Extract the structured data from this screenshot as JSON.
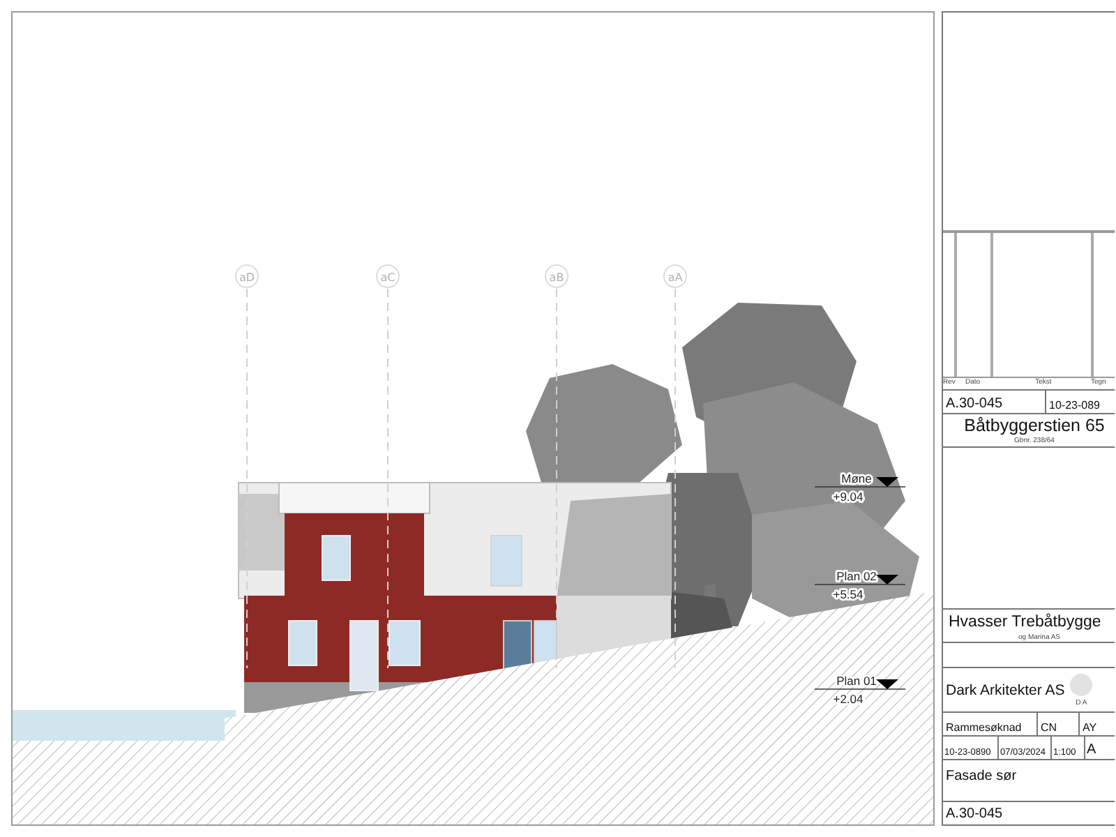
{
  "elevation": {
    "grid_lines": [
      {
        "label": "aD"
      },
      {
        "label": "aC"
      },
      {
        "label": "aB"
      },
      {
        "label": "aA"
      }
    ],
    "levels": [
      {
        "name": "Møne",
        "elevation": "+9.04"
      },
      {
        "name": "Plan 02",
        "elevation": "+5.54"
      },
      {
        "name": "Plan 01",
        "elevation": "+2.04"
      }
    ]
  },
  "title_block": {
    "revision_headers": [
      "Rev",
      "Dato",
      "Tekst",
      "Tegn"
    ],
    "drawing_number": "A.30-045",
    "project_number": "10-23-089",
    "project_name": "Båtbyggerstien 65",
    "property_id": "Gbnr. 238/64",
    "client": "Hvasser Trebåtbygge",
    "client_line_2": "og Marina AS",
    "architect": "Dark Arkitekter AS",
    "logo_letters": "D A",
    "phase": "Rammesøknad",
    "drawn_by": "CN",
    "checked_by": "AY",
    "project_number_2": "10-23-0890",
    "date": "07/03/2024",
    "scale": "1:100",
    "sheet": "A",
    "sheet_title": "Fasade sør",
    "drawing_number_2": "A.30-045"
  }
}
